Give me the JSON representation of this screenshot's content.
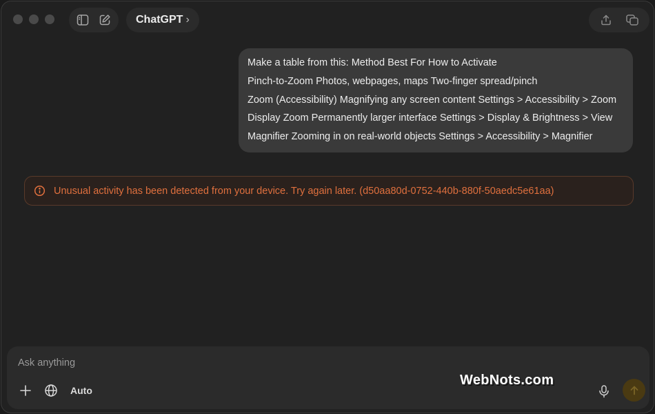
{
  "window": {
    "traffic_lights": [
      "close",
      "minimize",
      "zoom"
    ]
  },
  "toolbar": {
    "left_icons": [
      "sidebar-icon",
      "new-chat-icon"
    ],
    "model_label": "ChatGPT",
    "model_chevron": "›",
    "right_icons": [
      "share-icon",
      "temporary-chat-icon"
    ]
  },
  "conversation": {
    "user_message_lines": [
      "Make a table from this: Method Best For How to Activate",
      "Pinch-to-Zoom Photos, webpages, maps Two-finger spread/pinch",
      "Zoom (Accessibility) Magnifying any screen content Settings > Accessibility > Zoom",
      "Display Zoom Permanently larger interface Settings > Display & Brightness > View",
      "Magnifier Zooming in on real-world objects Settings > Accessibility > Magnifier"
    ],
    "error": {
      "icon": "info-circle-icon",
      "text": "Unusual activity has been detected from your device. Try again later. (d50aa80d-0752-440b-880f-50aedc5e61aa)",
      "color": "#e0703e"
    }
  },
  "composer": {
    "placeholder": "Ask anything",
    "value": "",
    "auto_label": "Auto",
    "tool_icons": [
      "plus-icon",
      "globe-icon"
    ],
    "mic_icon": "microphone-icon",
    "send_icon": "arrow-up-icon"
  },
  "watermark": {
    "text": "WebNots.com"
  }
}
